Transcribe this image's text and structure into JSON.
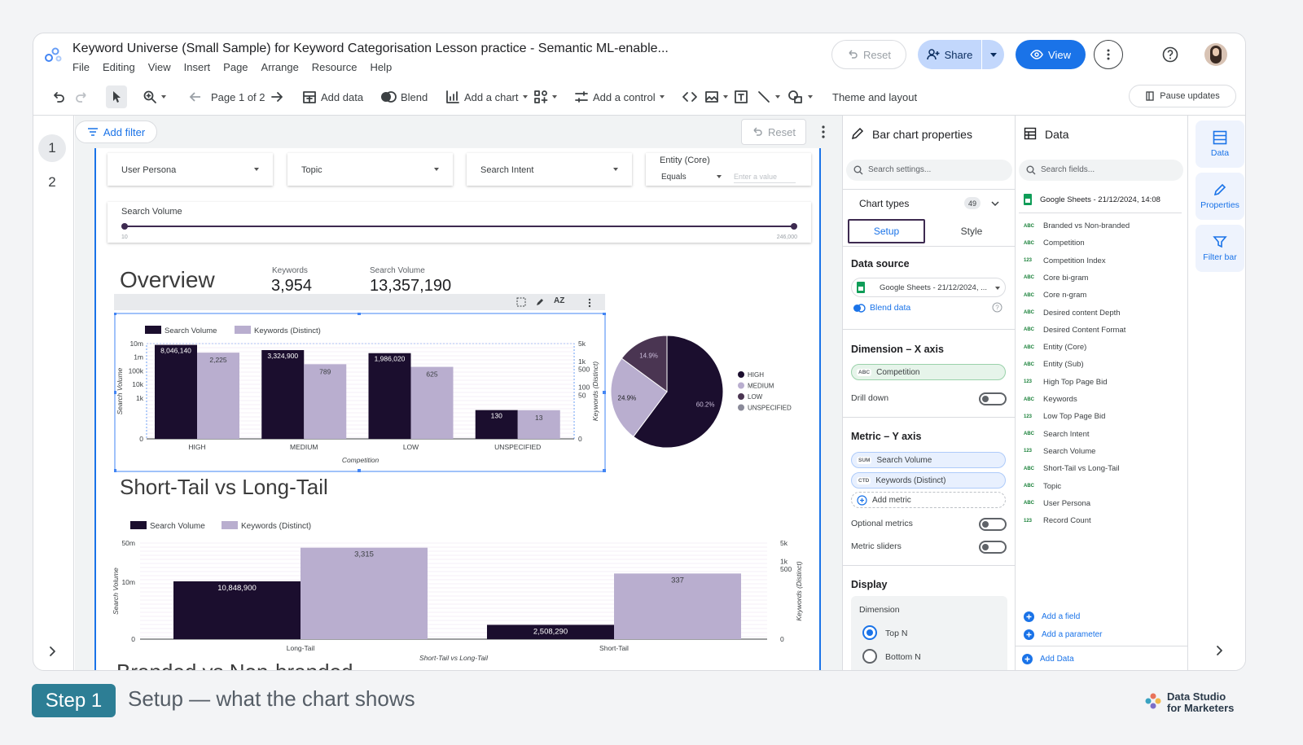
{
  "header": {
    "title": "Keyword Universe (Small Sample) for Keyword Categorisation Lesson practice - Semantic ML-enable...",
    "menu": [
      "File",
      "Editing",
      "View",
      "Insert",
      "Page",
      "Arrange",
      "Resource",
      "Help"
    ],
    "reset_label": "Reset",
    "share_label": "Share",
    "view_label": "View"
  },
  "toolbar": {
    "page_label": "Page 1 of 2",
    "add_data": "Add data",
    "blend": "Blend",
    "add_chart": "Add a chart",
    "add_control": "Add a control",
    "theme_layout": "Theme and layout",
    "pause_updates": "Pause updates"
  },
  "pages": [
    "1",
    "2"
  ],
  "canvas": {
    "add_filter": "Add filter",
    "reset": "Reset",
    "controls": {
      "user_persona": "User Persona",
      "topic": "Topic",
      "search_intent": "Search Intent",
      "entity_label": "Entity (Core)",
      "entity_operator": "Equals",
      "entity_placeholder": "Enter a value"
    },
    "slider": {
      "label": "Search Volume",
      "min": "10",
      "max": "246,000"
    },
    "overview": {
      "title": "Overview",
      "kpi1_label": "Keywords",
      "kpi1_value": "3,954",
      "kpi2_label": "Search Volume",
      "kpi2_value": "13,357,190"
    },
    "section2_title": "Short-Tail vs Long-Tail",
    "section3_title": "Branded vs Non-branded"
  },
  "chart_data": [
    {
      "type": "bar",
      "scale": "log",
      "categories": [
        "HIGH",
        "MEDIUM",
        "LOW",
        "UNSPECIFIED"
      ],
      "series": [
        {
          "name": "Search Volume",
          "values": [
            8046140,
            3324900,
            1986020,
            130
          ],
          "labels": [
            "8,046,140",
            "3,324,900",
            "1,986,020",
            "130"
          ],
          "color": "#1b0e2e"
        },
        {
          "name": "Keywords (Distinct)",
          "values": [
            2225,
            789,
            625,
            13
          ],
          "labels": [
            "2,225",
            "789",
            "625",
            "13"
          ],
          "color": "#b9aecf"
        }
      ],
      "xlabel": "Competition",
      "ylabel": "Search Volume",
      "y2label": "Keywords (Distinct)",
      "y_ticks": [
        "10m",
        "1m",
        "100k",
        "10k",
        "1k",
        "0"
      ],
      "y2_ticks": [
        "5k",
        "1k",
        "500",
        "100",
        "50",
        "0"
      ]
    },
    {
      "type": "pie",
      "categories": [
        "HIGH",
        "MEDIUM",
        "LOW",
        "UNSPECIFIED"
      ],
      "values": [
        60.2,
        24.9,
        14.9,
        0
      ],
      "labels": [
        "60.2%",
        "24.9%",
        "14.9%",
        ""
      ],
      "colors": [
        "#1b0e2e",
        "#b9aecf",
        "#4a3552",
        "#8a8a99"
      ]
    },
    {
      "type": "bar",
      "categories": [
        "Long-Tail",
        "Short-Tail"
      ],
      "series": [
        {
          "name": "Search Volume",
          "values": [
            10848900,
            2508290
          ],
          "labels": [
            "10,848,900",
            "2,508,290"
          ],
          "color": "#1b0e2e"
        },
        {
          "name": "Keywords (Distinct)",
          "values": [
            3315,
            337
          ],
          "labels": [
            "3,315",
            "337"
          ],
          "color": "#b9aecf"
        }
      ],
      "xlabel": "Short-Tail vs Long-Tail",
      "ylabel": "Search Volume",
      "y2label": "Keywords (Distinct)",
      "y_ticks": [
        "50m",
        "10m",
        "0"
      ],
      "y2_ticks": [
        "5k",
        "1k",
        "500",
        "0"
      ]
    }
  ],
  "properties": {
    "title": "Bar chart properties",
    "search_placeholder": "Search settings...",
    "chart_types": "Chart types",
    "chart_types_count": "49",
    "tab_setup": "Setup",
    "tab_style": "Style",
    "data_source": "Data source",
    "source_name": "Google Sheets - 21/12/2024, ...",
    "blend_data": "Blend data",
    "dimension": "Dimension – X axis",
    "dimension_field": "Competition",
    "drill_down": "Drill down",
    "metric": "Metric – Y axis",
    "metric1": "Search Volume",
    "metric2": "Keywords (Distinct)",
    "add_metric": "Add metric",
    "optional_metrics": "Optional metrics",
    "metric_sliders": "Metric sliders",
    "display": "Display",
    "display_dimension": "Dimension",
    "top_n": "Top N",
    "bottom_n": "Bottom N"
  },
  "data_panel": {
    "title": "Data",
    "search_placeholder": "Search fields...",
    "source": "Google Sheets - 21/12/2024, 14:08",
    "fields": [
      {
        "type": "ABC",
        "name": "Branded vs Non-branded"
      },
      {
        "type": "ABC",
        "name": "Competition"
      },
      {
        "type": "123",
        "name": "Competition Index"
      },
      {
        "type": "ABC",
        "name": "Core bi-gram"
      },
      {
        "type": "ABC",
        "name": "Core n-gram"
      },
      {
        "type": "ABC",
        "name": "Desired content Depth"
      },
      {
        "type": "ABC",
        "name": "Desired Content Format"
      },
      {
        "type": "ABC",
        "name": "Entity (Core)"
      },
      {
        "type": "ABC",
        "name": "Entity (Sub)"
      },
      {
        "type": "123",
        "name": "High Top Page Bid"
      },
      {
        "type": "ABC",
        "name": "Keywords"
      },
      {
        "type": "123",
        "name": "Low Top Page Bid"
      },
      {
        "type": "ABC",
        "name": "Search Intent"
      },
      {
        "type": "123",
        "name": "Search Volume"
      },
      {
        "type": "ABC",
        "name": "Short-Tail vs Long-Tail"
      },
      {
        "type": "ABC",
        "name": "Topic"
      },
      {
        "type": "ABC",
        "name": "User Persona"
      },
      {
        "type": "123",
        "name": "Record Count"
      }
    ],
    "add_field": "Add a field",
    "add_parameter": "Add a parameter",
    "add_data": "Add Data"
  },
  "side_nav": {
    "data": "Data",
    "properties": "Properties",
    "filter_bar": "Filter bar"
  },
  "footer": {
    "step_badge": "Step 1",
    "caption": "Setup — what the chart shows",
    "brand_line1": "Data Studio",
    "brand_line2": "for Marketers"
  }
}
